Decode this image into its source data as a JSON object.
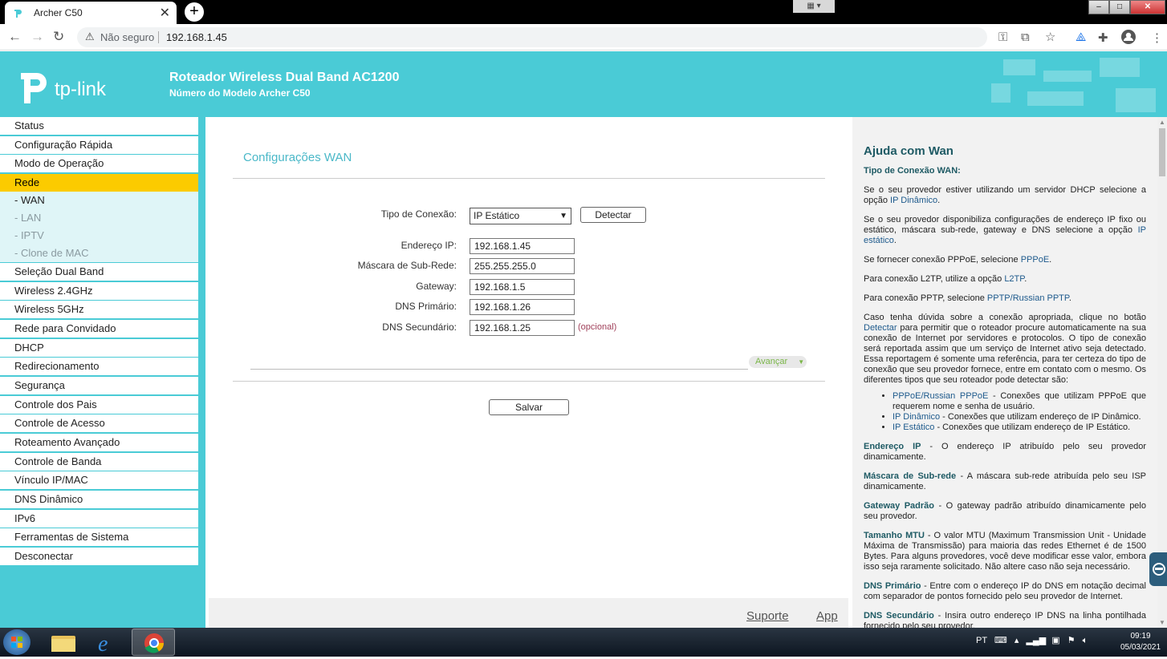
{
  "browser": {
    "tab_title": "Archer C50",
    "tab_close": "✕",
    "new_tab": "+",
    "security_label": "Não seguro",
    "url": "192.168.1.45"
  },
  "header": {
    "logo_text": "tp-link",
    "model_name": "Roteador Wireless Dual Band AC1200",
    "model_number": "Número do Modelo Archer C50"
  },
  "sidebar": {
    "items": [
      "Status",
      "Configuração Rápida",
      "Modo de Operação",
      "Rede",
      "Seleção Dual Band",
      "Wireless 2.4GHz",
      "Wireless 5GHz",
      "Rede para Convidado",
      "DHCP",
      "Redirecionamento",
      "Segurança",
      "Controle dos Pais",
      "Controle de Acesso",
      "Roteamento Avançado",
      "Controle de Banda",
      "Vínculo IP/MAC",
      "DNS Dinâmico",
      "IPv6",
      "Ferramentas de Sistema",
      "Desconectar"
    ],
    "subitems": [
      "- WAN",
      "- LAN",
      "- IPTV",
      "- Clone de MAC"
    ]
  },
  "main": {
    "title": "Configurações WAN",
    "connection_type_label": "Tipo de Conexão:",
    "connection_type_value": "IP Estático",
    "detect_button": "Detectar",
    "ip_label": "Endereço IP:",
    "ip_value": "192.168.1.45",
    "mask_label": "Máscara de Sub-Rede:",
    "mask_value": "255.255.255.0",
    "gateway_label": "Gateway:",
    "gateway_value": "192.168.1.5",
    "dns1_label": "DNS Primário:",
    "dns1_value": "192.168.1.26",
    "dns2_label": "DNS Secundário:",
    "dns2_value": "192.168.1.25",
    "optional_label": "(opcional)",
    "advanced_label": "Avançar",
    "save_button": "Salvar",
    "footer_support": "Suporte",
    "footer_app": "App"
  },
  "help": {
    "title": "Ajuda com Wan",
    "h_tipo": "Tipo de Conexão WAN:",
    "p1a": "Se o seu provedor estiver utilizando um servidor DHCP selecione a opção ",
    "p1b": "IP Dinâmico",
    "p1c": ".",
    "p2a": "Se o seu provedor disponibiliza configurações de endereço IP fixo ou estático, máscara sub-rede, gateway e DNS selecione a opção ",
    "p2b": "IP estático",
    "p2c": ".",
    "p3a": "Se fornecer conexão PPPoE, selecione ",
    "p3b": "PPPoE",
    "p3c": ".",
    "p4a": "Para conexão L2TP, utilize a opção ",
    "p4b": "L2TP",
    "p4c": ".",
    "p5a": "Para conexão PPTP, selecione ",
    "p5b": "PPTP/Russian PPTP",
    "p5c": ".",
    "p6a": "Caso tenha dúvida sobre a conexão apropriada, clique no botão ",
    "p6b": "Detectar",
    "p6c": " para permitir que o roteador procure automaticamente na sua conexão de Internet por servidores e protocolos. O tipo de conexão será reportada assim que um serviço de Internet ativo seja detectado. Essa reportagem é somente uma referência, para ter certeza do tipo de conexão que seu provedor fornece, entre em contato com o mesmo. Os diferentes tipos que seu roteador pode detectar são:",
    "li1a": "PPPoE/Russian PPPoE",
    "li1b": " - Conexões que utilizam PPPoE que requerem nome e senha de usuário.",
    "li2a": "IP Dinâmico",
    "li2b": " - Conexões que utilizam endereço de IP Dinâmico.",
    "li3a": "IP Estático",
    "li3b": " - Conexões que utilizam endereço de IP Estático.",
    "t1a": "Endereço IP",
    "t1b": " - O endereço IP atribuído pelo seu provedor dinamicamente.",
    "t2a": "Máscara de Sub-rede",
    "t2b": " - A máscara sub-rede atribuída pelo seu ISP dinamicamente.",
    "t3a": "Gateway Padrão",
    "t3b": " - O gateway padrão atribuído dinamicamente pelo seu provedor.",
    "t4a": "Tamanho MTU",
    "t4b": " - O valor MTU (Maximum Transmission Unit - Unidade Máxima de Transmissão) para maioria das redes Ethernet é de 1500 Bytes. Para alguns provedores, você deve modificar esse valor, embora isso seja raramente solicitado. Não altere caso não seja necessário.",
    "t5a": "DNS Primário",
    "t5b": " - Entre com o endereço IP do DNS em notação decimal com separador de pontos fornecido pelo seu provedor de Internet.",
    "t6a": "DNS Secundário",
    "t6b": " - Insira outro endereço IP DNS na linha pontilhada fornecido pelo seu provedor."
  },
  "taskbar": {
    "language": "PT",
    "time": "09:19",
    "date": "05/03/2021"
  },
  "colors": {
    "brand_teal": "#4acbd6",
    "active_menu": "#fccb00"
  }
}
